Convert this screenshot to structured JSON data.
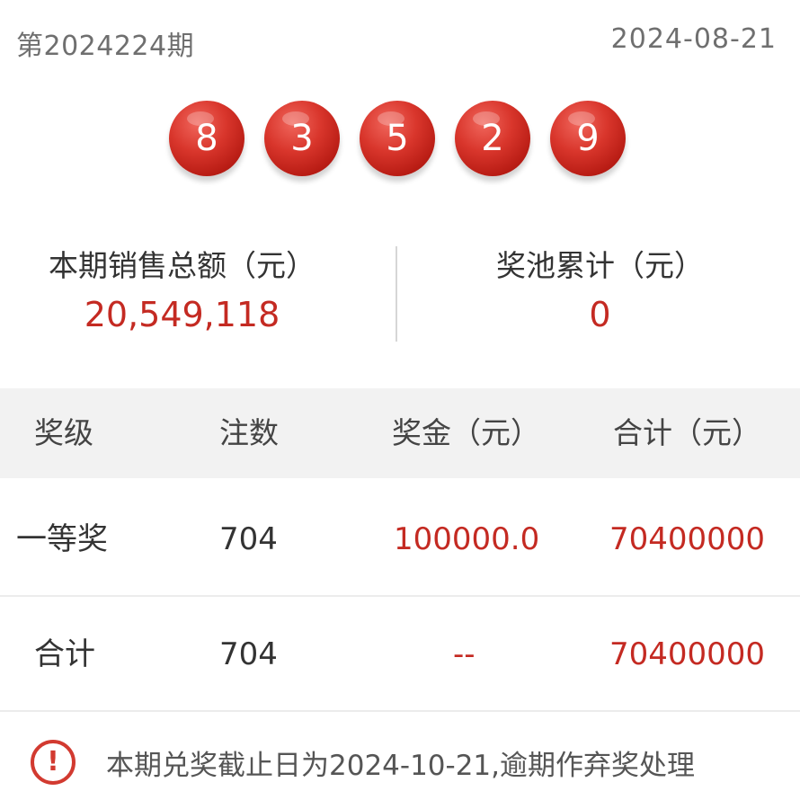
{
  "header": {
    "issue": "第2024224期",
    "date": "2024-08-21"
  },
  "balls": [
    "8",
    "3",
    "5",
    "2",
    "9"
  ],
  "stats": {
    "sales_label": "本期销售总额（元）",
    "sales_value": "20,549,118",
    "pool_label": "奖池累计（元）",
    "pool_value": "0"
  },
  "table": {
    "headers": [
      "奖级",
      "注数",
      "奖金（元）",
      "合计（元）"
    ],
    "rows": [
      [
        "一等奖",
        "704",
        "100000.0",
        "70400000"
      ],
      [
        "合计",
        "704",
        "--",
        "70400000"
      ]
    ]
  },
  "notice": {
    "icon": "exclamation-circle-icon",
    "text": "本期兑奖截止日为2024-10-21,逾期作弃奖处理"
  },
  "colors": {
    "accent_red": "#c42a22",
    "ball_red": "#d9362c",
    "header_bg": "#f2f2f2"
  }
}
